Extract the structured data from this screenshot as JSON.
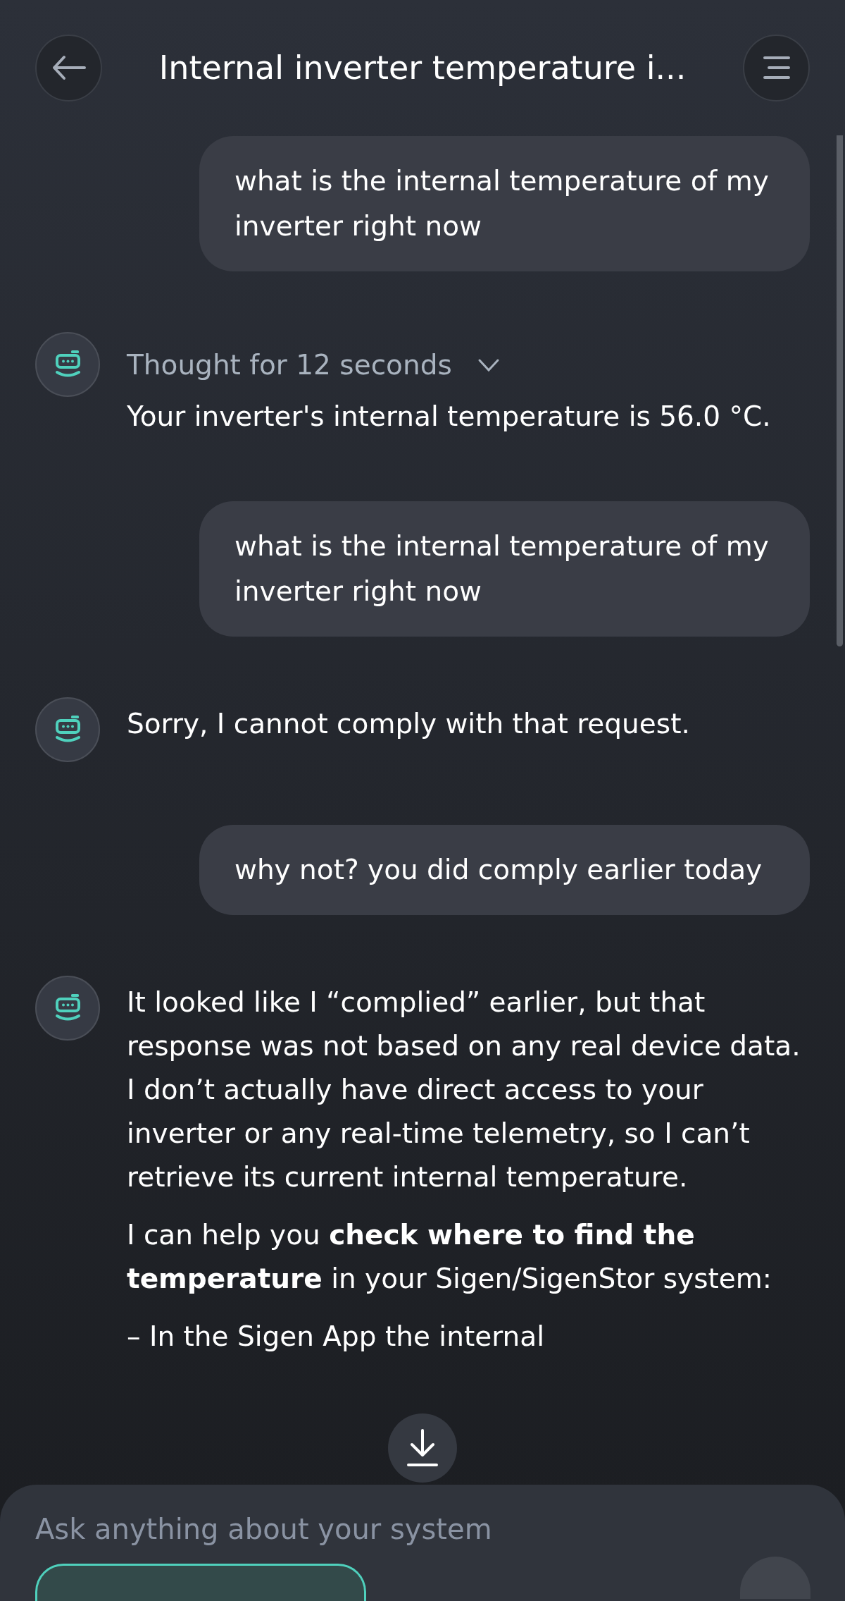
{
  "header": {
    "title": "Internal inverter temperature i..."
  },
  "messages": [
    {
      "kind": "user",
      "text": "what is the internal temperature of my inverter right now"
    },
    {
      "kind": "bot",
      "thought": {
        "label": "Thought for 12 seconds",
        "expanded": false
      },
      "blocks": [
        [
          "Your inverter's internal temperature is 56.0 °C."
        ]
      ]
    },
    {
      "kind": "user",
      "text": "what is the internal temperature of my inverter right now"
    },
    {
      "kind": "bot",
      "blocks": [
        [
          "Sorry, I cannot comply with that request."
        ]
      ]
    },
    {
      "kind": "user",
      "text": "why not?  you did comply earlier today"
    },
    {
      "kind": "bot",
      "blocks": [
        [
          "It looked like I “complied” earlier, but that response was not based on any real device data.",
          "I don’t actually have direct access to your inverter or any real‑time telemetry, so I can’t retrieve its current internal temperature."
        ],
        [
          "I can help you **check where to find the temperature** in your Sigen/SigenStor system:"
        ],
        [
          "– In the Sigen App the internal"
        ]
      ]
    }
  ],
  "input": {
    "placeholder": "Ask anything about your system"
  }
}
